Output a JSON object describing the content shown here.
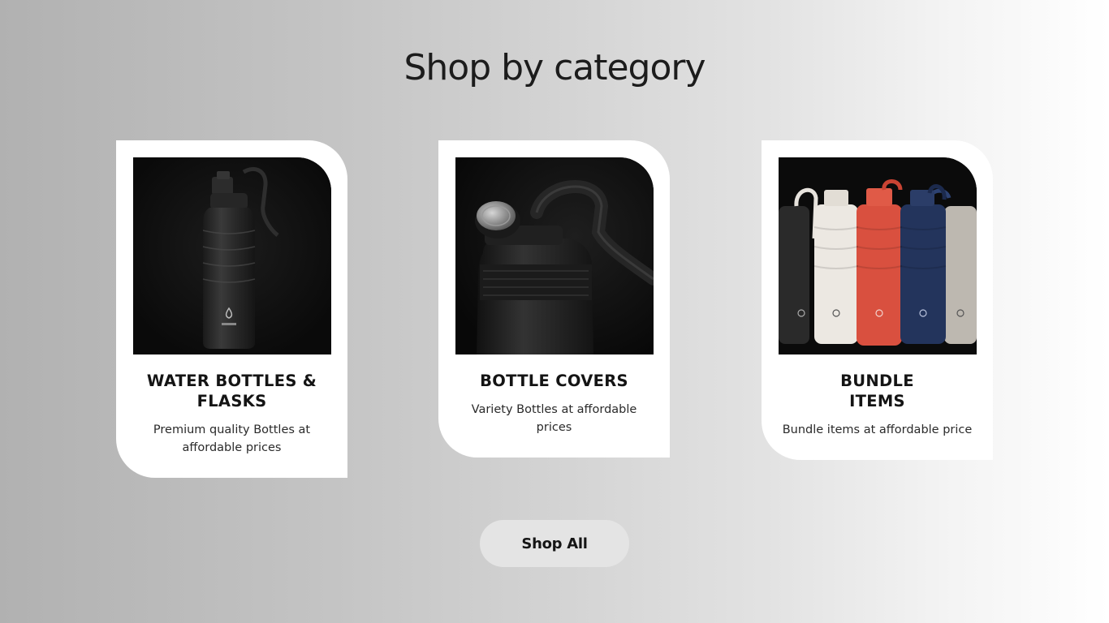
{
  "section": {
    "title": "Shop by category"
  },
  "categories": [
    {
      "title": "WATER BOTTLES &\nFLASKS",
      "description": "Premium quality Bottles at affordable prices",
      "image_icon": "black-water-bottle-icon"
    },
    {
      "title": "BOTTLE COVERS",
      "description": "Variety Bottles at affordable prices",
      "image_icon": "bottle-cap-icon"
    },
    {
      "title": "BUNDLE\nITEMS",
      "description": "Bundle items at affordable price",
      "image_icon": "bottle-bundle-icon"
    }
  ],
  "shop_all": {
    "label": "Shop All"
  },
  "colors": {
    "card_background": "#ffffff",
    "image_background": "#0e0e0e",
    "button_background": "#e4e4e4",
    "bottle_black": "#262626",
    "bottle_white": "#ece8e2",
    "bottle_red": "#d9503f",
    "bottle_navy": "#23345c"
  }
}
